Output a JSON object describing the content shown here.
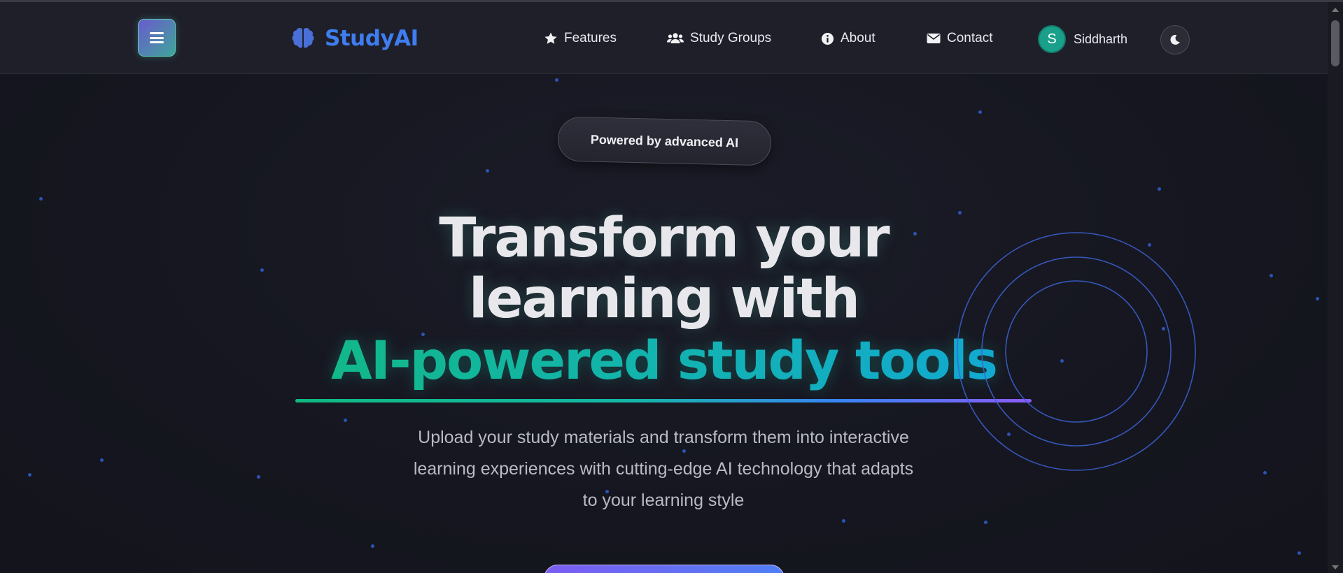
{
  "navbar": {
    "brand_name": "StudyAI",
    "links": [
      {
        "label": "Features",
        "icon": "star-icon"
      },
      {
        "label": "Study Groups",
        "icon": "users-icon"
      },
      {
        "label": "About",
        "icon": "info-icon"
      },
      {
        "label": "Contact",
        "icon": "envelope-icon"
      }
    ],
    "user": {
      "initial": "S",
      "name": "Siddharth"
    },
    "theme_toggle_icon": "moon-icon",
    "menu_icon": "hamburger-icon",
    "brand_icon": "brain-icon"
  },
  "hero": {
    "badge": "Powered by advanced AI",
    "title_line1": "Transform your",
    "title_line2": "learning with",
    "title_highlight": "AI-powered study tools",
    "subtitle_line1": "Upload your study materials and transform them into interactive",
    "subtitle_line2": "learning experiences with cutting-edge AI technology that adapts",
    "subtitle_line3": "to your learning style"
  },
  "colors": {
    "brand": "#3f7df0",
    "accent_teal": "#14b8a6",
    "accent_green": "#10b981",
    "accent_purple": "#8b5cf6",
    "background": "#15161f"
  }
}
